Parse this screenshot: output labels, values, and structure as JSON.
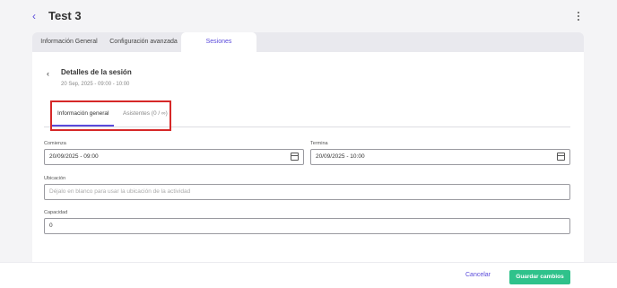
{
  "header": {
    "title": "Test 3",
    "back_icon": "chevron-left-icon",
    "menu_icon": "kebab-icon"
  },
  "tabs": [
    {
      "label": "Información General"
    },
    {
      "label": "Configuración avanzada"
    },
    {
      "label": "Sesiones",
      "active": true
    }
  ],
  "session": {
    "title": "Detalles de la sesión",
    "subtitle": "20 Sep, 2025 - 09:00 - 10:00"
  },
  "subtabs": [
    {
      "label": "Información general",
      "active": true
    },
    {
      "label": "Asistentes (0 / ∞)"
    }
  ],
  "form": {
    "start": {
      "label": "Comienza",
      "value": "20/09/2025 - 09:00"
    },
    "end": {
      "label": "Termina",
      "value": "20/09/2025 - 10:00"
    },
    "location": {
      "label": "Ubicación",
      "placeholder": "Déjalo en blanco para usar la ubicación de la actividad"
    },
    "capacity": {
      "label": "Capacidad",
      "value": "0"
    }
  },
  "footer": {
    "cancel_label": "Cancelar",
    "save_label": "Guardar cambios"
  },
  "colors": {
    "accent": "#5b4bdb",
    "save": "#2fc28b",
    "highlight": "#d62828"
  }
}
